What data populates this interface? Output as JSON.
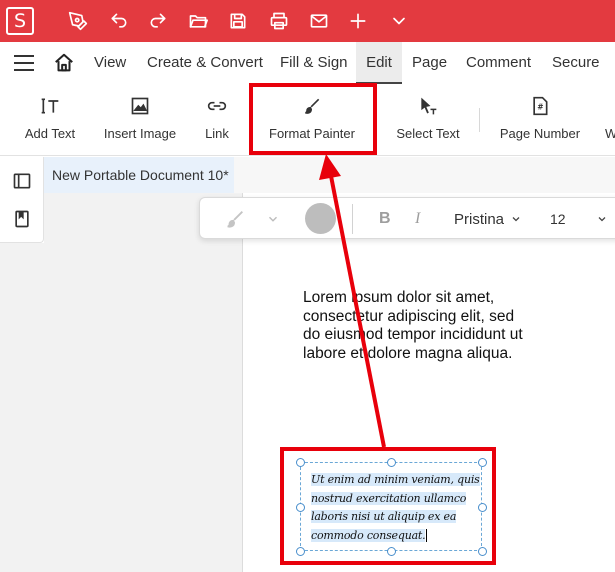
{
  "app": {
    "logo_letter": "S"
  },
  "titlebar_icons": [
    "pen-icon",
    "undo-icon",
    "redo-icon",
    "open-folder-icon",
    "save-icon",
    "print-icon",
    "mail-icon",
    "plus-icon",
    "chevron-down-icon"
  ],
  "menu": {
    "items": [
      "View",
      "Create & Convert",
      "Fill & Sign",
      "Edit",
      "Page",
      "Comment",
      "Secure"
    ],
    "active": "Edit"
  },
  "ribbon": {
    "add_text": "Add Text",
    "insert_image": "Insert Image",
    "link": "Link",
    "format_painter": "Format Painter",
    "select_text": "Select Text",
    "page_number": "Page Number",
    "cut_off": "W"
  },
  "document": {
    "tab_title": "New Portable Document 10*"
  },
  "format_toolbar": {
    "font_name": "Pristina",
    "font_size": "12"
  },
  "page_content": {
    "lorem_lines": [
      "Lorem ipsum dolor sit amet,",
      "consectetur adipiscing elit, sed",
      "do eiusmod tempor incididunt ut",
      "labore et dolore magna aliqua."
    ],
    "cursive_lines": [
      "Ut enim ad minim veniam, quis",
      "nostrud exercitation ullamco",
      "laboris nisi ut aliquip ex ea",
      "commodo consequat."
    ]
  },
  "colors": {
    "titlebar": "#e33a40",
    "annotation": "#e8000b",
    "selection": "#4a8fcc"
  }
}
